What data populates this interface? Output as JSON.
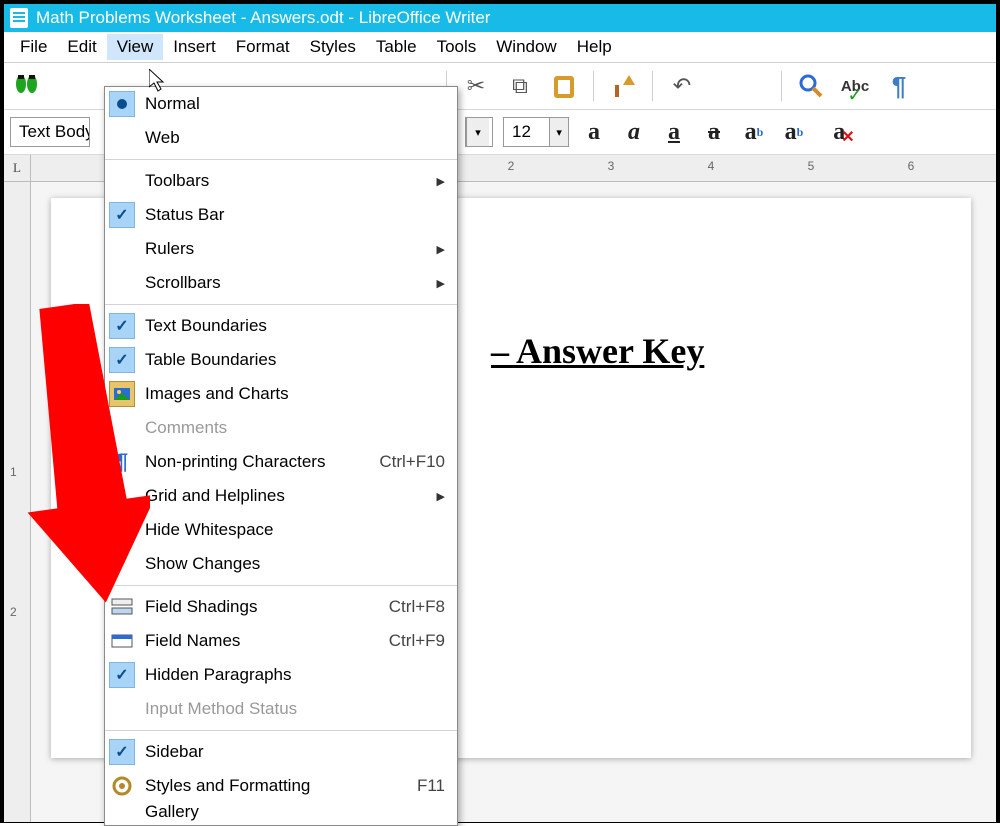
{
  "titlebar": {
    "text": "Math Problems Worksheet - Answers.odt - LibreOffice Writer"
  },
  "menubar": {
    "items": [
      "File",
      "Edit",
      "View",
      "Insert",
      "Format",
      "Styles",
      "Table",
      "Tools",
      "Window",
      "Help"
    ],
    "active_index": 2
  },
  "toolbar2": {
    "style_combo": "Text Body",
    "fontsize": "12"
  },
  "ruler_h": {
    "labels": [
      "2",
      "3",
      "4",
      "5",
      "6"
    ]
  },
  "ruler_v": {
    "labels": [
      "1",
      "2"
    ]
  },
  "document": {
    "heading_visible": "– Answer Key"
  },
  "view_menu": {
    "normal": "Normal",
    "web": "Web",
    "toolbars": "Toolbars",
    "statusbar": "Status Bar",
    "rulers": "Rulers",
    "scrollbars": "Scrollbars",
    "text_boundaries": "Text Boundaries",
    "table_boundaries": "Table Boundaries",
    "images_charts": "Images and Charts",
    "comments": "Comments",
    "nonprinting": "Non-printing Characters",
    "nonprinting_shortcut": "Ctrl+F10",
    "grid_help": "Grid and Helplines",
    "hide_whitespace": "Hide Whitespace",
    "show_changes": "Show Changes",
    "field_shadings": "Field Shadings",
    "field_shadings_shortcut": "Ctrl+F8",
    "field_names": "Field Names",
    "field_names_shortcut": "Ctrl+F9",
    "hidden_paragraphs": "Hidden Paragraphs",
    "input_method": "Input Method Status",
    "sidebar": "Sidebar",
    "styles_formatting": "Styles and Formatting",
    "styles_formatting_shortcut": "F11",
    "gallery": "Gallery"
  }
}
